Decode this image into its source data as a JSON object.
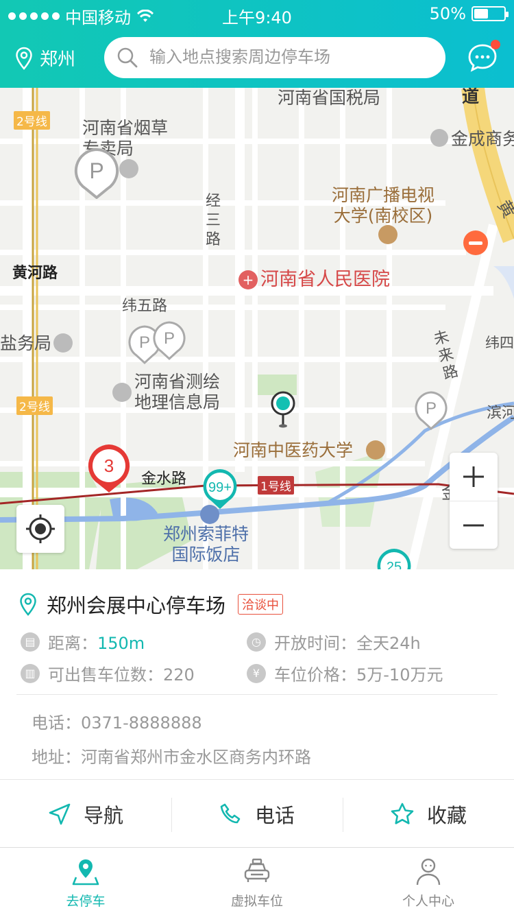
{
  "status_bar": {
    "carrier": "中国移动",
    "time": "上午9:40",
    "battery": "50%"
  },
  "header": {
    "city": "郑州",
    "search_placeholder": "输入地点搜索周边停车场"
  },
  "map": {
    "labels": {
      "tax": "河南省国税局",
      "tobacco": "河南省烟草\n专卖局",
      "jincheng": "金成商务",
      "radio": "河南广播电视\n大学(南校区)",
      "jing3": "经\n三\n路",
      "huanghe": "黄河路",
      "hospital": "河南省人民医院",
      "wei5": "纬五路",
      "salt": "盐务局",
      "survey": "河南省测绘\n地理信息局",
      "weilai": "未\n来\n路",
      "wei4": "纬四",
      "bin": "滨河",
      "tcm": "河南中医药大学",
      "jinshui": "金水路",
      "sofitel": "郑州索菲特\n国际饭店",
      "huang_road": "黄",
      "dao": "道",
      "jin_edge": "金"
    },
    "line_tags": {
      "line2_top": "2号线",
      "line2_bottom": "2号线",
      "line1": "1号线"
    },
    "pins": {
      "cluster_red": "3",
      "cluster_teal_1": "99+",
      "cluster_teal_2": "25",
      "parking": "P"
    }
  },
  "parking_card": {
    "name": "郑州会展中心停车场",
    "status_tag": "洽谈中",
    "distance_label": "距离：",
    "distance_value": "150m",
    "hours_label": "开放时间：",
    "hours_value": "全天24h",
    "spaces_label": "可出售车位数：",
    "spaces_value": "220",
    "price_label": "车位价格：",
    "price_value": "5万-10万元",
    "phone_label": "电话：",
    "phone_value": "0371-8888888",
    "address_label": "地址：",
    "address_value": "河南省郑州市金水区商务内环路"
  },
  "actions": {
    "navigate": "导航",
    "call": "电话",
    "favorite": "收藏"
  },
  "tabbar": {
    "park": "去停车",
    "virtual": "虚拟车位",
    "profile": "个人中心"
  },
  "colors": {
    "accent": "#13b8b0",
    "header_gradient_start": "#12c8b4",
    "header_gradient_end": "#0bbfd0",
    "tag_red": "#e8503c",
    "cluster_red": "#e53935"
  }
}
